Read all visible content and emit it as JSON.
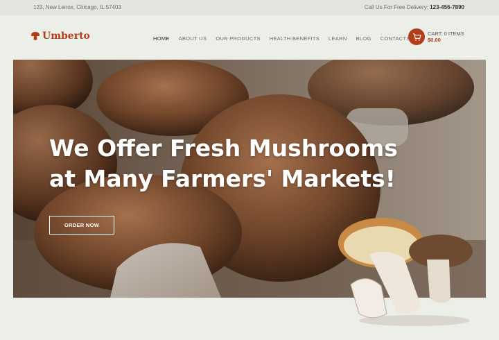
{
  "topbar": {
    "address": "123, New Lenox, Chicago, IL 57403",
    "delivery_label": "Call Us For Free Delivery:",
    "phone": "123-456-7890"
  },
  "brand": {
    "name": "Umberto",
    "color": "#b23d1b"
  },
  "nav": {
    "items": [
      {
        "label": "HOME",
        "active": true
      },
      {
        "label": "ABOUT US"
      },
      {
        "label": "OUR PRODUCTS"
      },
      {
        "label": "HEALTH BENEFITS"
      },
      {
        "label": "LEARN"
      },
      {
        "label": "BLOG"
      },
      {
        "label": "CONTACTS"
      }
    ]
  },
  "cart": {
    "label": "CART: 0 ITEMS",
    "amount": "$0.00",
    "icon": "cart-icon"
  },
  "hero": {
    "title": "We Offer Fresh Mushrooms at Many Farmers' Markets!",
    "cta": "ORDER NOW"
  }
}
